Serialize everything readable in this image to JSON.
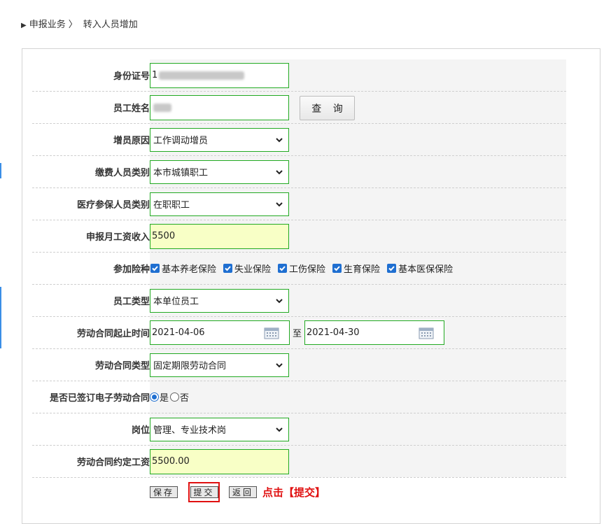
{
  "breadcrumb": {
    "parent": "申报业务",
    "separator": "〉",
    "current": "转入人员增加"
  },
  "form": {
    "id_number": {
      "label": "身份证号",
      "value_prefix": "1"
    },
    "employee_name": {
      "label": "员工姓名",
      "query_button": "查 询"
    },
    "increase_reason": {
      "label": "增员原因",
      "selected": "工作调动增员"
    },
    "payer_category": {
      "label": "缴费人员类别",
      "selected": "本市城镇职工"
    },
    "medical_category": {
      "label": "医疗参保人员类别",
      "selected": "在职职工"
    },
    "monthly_income": {
      "label": "申报月工资收入",
      "value": "5500"
    },
    "insurance": {
      "label": "参加险种",
      "items": [
        "基本养老保险",
        "失业保险",
        "工伤保险",
        "生育保险",
        "基本医保保险"
      ]
    },
    "employee_type": {
      "label": "员工类型",
      "selected": "本单位员工"
    },
    "contract_period": {
      "label": "劳动合同起止时间",
      "start": "2021-04-06",
      "to": "至",
      "end": "2021-04-30"
    },
    "contract_type": {
      "label": "劳动合同类型",
      "selected": "固定期限劳动合同"
    },
    "e_contract": {
      "label": "是否已签订电子劳动合同",
      "yes": "是",
      "no": "否",
      "selected": "是"
    },
    "position": {
      "label": "岗位",
      "selected": "管理、专业技术岗"
    },
    "contract_salary": {
      "label": "劳动合同约定工资",
      "value": "5500.00"
    }
  },
  "actions": {
    "save": "保存",
    "submit": "提交",
    "back": "返回",
    "hint": "点击【提交】"
  },
  "colors": {
    "field_border": "#22aa22",
    "highlight": "#e01010",
    "checkbox": "#1f6fd1",
    "yellow_field": "#f8ffc6"
  }
}
